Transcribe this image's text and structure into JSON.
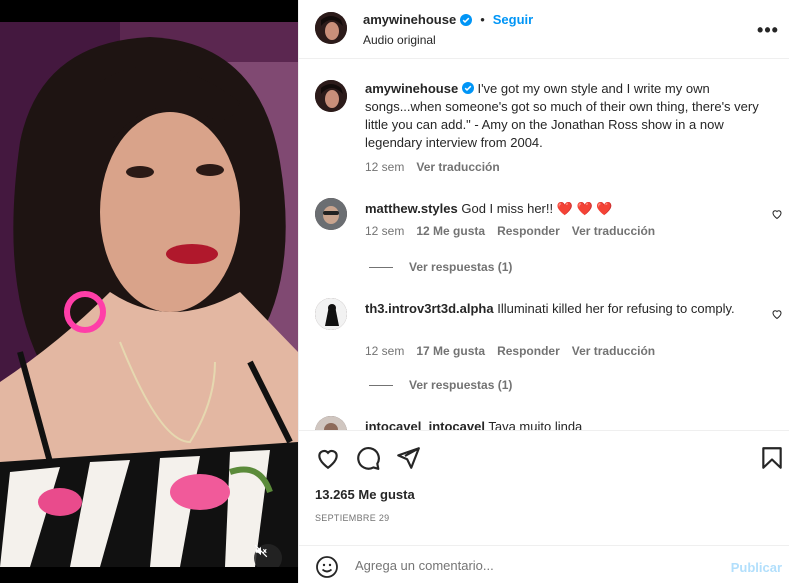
{
  "post": {
    "username": "amywinehouse",
    "follow_label": "Seguir",
    "audio_label": "Audio original",
    "caption_user": "amywinehouse",
    "caption": "I've got my own style and I write my own songs...when someone's got so much of their own thing, there's very little you can add.\" - Amy on the Jonathan Ross show in a now legendary interview from 2004.",
    "caption_time": "12 sem",
    "caption_translate": "Ver traducción"
  },
  "comments": [
    {
      "user": "matthew.styles",
      "text": "God I miss her!!",
      "hearts": "❤️ ❤️ ❤️",
      "time": "12 sem",
      "likes": "12 Me gusta",
      "reply": "Responder",
      "translate": "Ver traducción",
      "view_replies": "Ver respuestas (1)"
    },
    {
      "user": "th3.introv3rt3d.alpha",
      "text": "Illuminati killed her for refusing to comply.",
      "time": "12 sem",
      "likes": "17 Me gusta",
      "reply": "Responder",
      "translate": "Ver traducción",
      "view_replies": "Ver respuestas (1)"
    },
    {
      "user": "intocavel_intocavel",
      "text": "Tava muito linda"
    }
  ],
  "footer": {
    "likes": "13.265 Me gusta",
    "date": "SEPTIEMBRE 29",
    "comment_placeholder": "Agrega un comentario...",
    "publish_label": "Publicar"
  },
  "colors": {
    "accent": "#0095f6",
    "publish_disabled": "#b2dffc",
    "heart": "#ed4956"
  },
  "icons": [
    "more-icon",
    "verified-icon",
    "heart-icon",
    "comment-icon",
    "share-icon",
    "bookmark-icon",
    "emoji-icon",
    "mute-icon"
  ]
}
